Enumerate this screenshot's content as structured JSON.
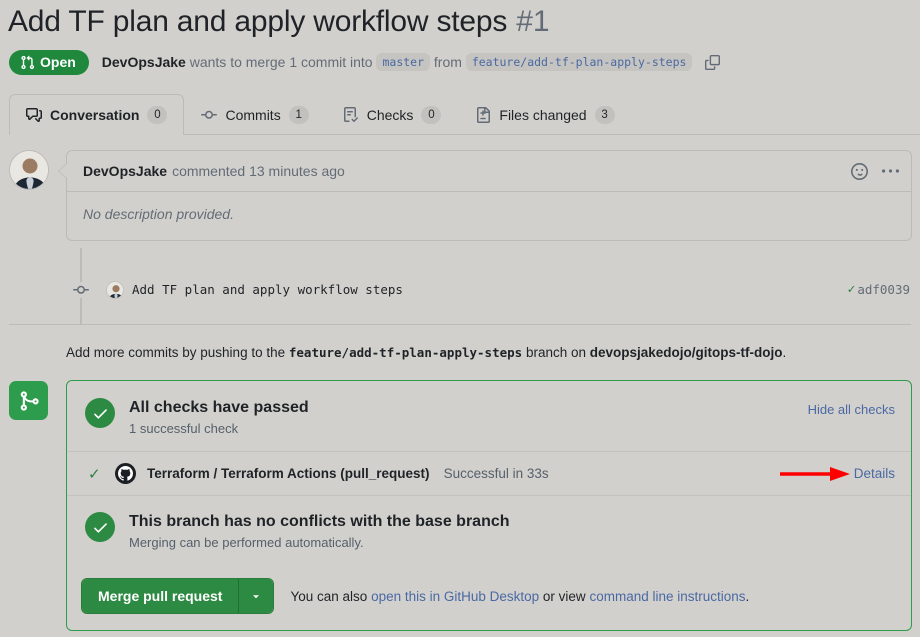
{
  "header": {
    "title": "Add TF plan and apply workflow steps",
    "number": "#1",
    "state_badge": "Open",
    "author": "DevOpsJake",
    "merge_text_1": "wants to merge 1 commit into",
    "base_branch": "master",
    "merge_text_2": "from",
    "head_branch": "feature/add-tf-plan-apply-steps",
    "copy_icon": "clipboard-copy-icon",
    "state_color": "#1f883d"
  },
  "tabs": [
    {
      "label": "Conversation",
      "count": "0",
      "icon": "comment-discussion-icon",
      "active": true
    },
    {
      "label": "Commits",
      "count": "1",
      "icon": "git-commit-icon",
      "active": false
    },
    {
      "label": "Checks",
      "count": "0",
      "icon": "checklist-icon",
      "active": false
    },
    {
      "label": "Files changed",
      "count": "3",
      "icon": "file-diff-icon",
      "active": false
    }
  ],
  "comment": {
    "author": "DevOpsJake",
    "meta": "commented 13 minutes ago",
    "body": "No description provided.",
    "reaction_icon": "smiley-icon",
    "menu_icon": "kebab-horizontal-icon"
  },
  "commit": {
    "message": "Add TF plan and apply workflow steps",
    "sha": "adf0039",
    "status_icon": "check-icon"
  },
  "add_more": {
    "prefix": "Add more commits by pushing to the",
    "branch": "feature/add-tf-plan-apply-steps",
    "middle": "branch on",
    "repo": "devopsjakedojo/gitops-tf-dojo",
    "suffix": "."
  },
  "merge_box": {
    "branch_icon": "git-merge-icon",
    "checks": {
      "title": "All checks have passed",
      "subtitle": "1 successful check",
      "hide_link": "Hide all checks"
    },
    "check_run": {
      "name": "Terraform / Terraform Actions (pull_request)",
      "status": "Successful in 33s",
      "details_link": "Details",
      "app_icon": "github-actions-mark-icon",
      "tick_icon": "check-icon"
    },
    "conflicts": {
      "title": "This branch has no conflicts with the base branch",
      "subtitle": "Merging can be performed automatically."
    },
    "actions": {
      "merge_button": "Merge pull request",
      "dropdown_icon": "triangle-down-icon",
      "help_prefix": "You can also",
      "help_link_1": "open this in GitHub Desktop",
      "help_middle": "or view",
      "help_link_2": "command line instructions",
      "help_suffix": "."
    },
    "border_color": "#2d9c4c"
  },
  "annotation": {
    "arrow_color": "#ff0000",
    "arrow_name": "red-pointer-arrow"
  }
}
